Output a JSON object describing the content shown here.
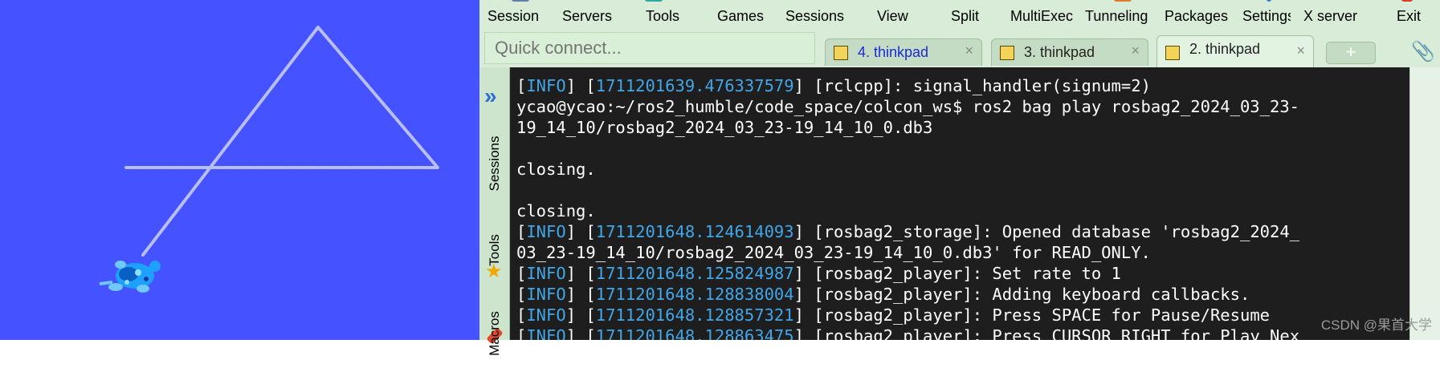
{
  "menubar": {
    "items": [
      {
        "label": "Session"
      },
      {
        "label": "Servers"
      },
      {
        "label": "Tools"
      },
      {
        "label": "Games"
      },
      {
        "label": "Sessions"
      },
      {
        "label": "View"
      },
      {
        "label": "Split"
      },
      {
        "label": "MultiExec"
      },
      {
        "label": "Tunneling"
      },
      {
        "label": "Packages"
      },
      {
        "label": "Settings"
      },
      {
        "label": "X server"
      },
      {
        "label": "Exit"
      }
    ]
  },
  "quick_connect": {
    "placeholder": "Quick connect..."
  },
  "tabs": [
    {
      "label": "4. thinkpad",
      "close": "×",
      "icon": "terminal-key-icon",
      "active": false
    },
    {
      "label": "3. thinkpad",
      "close": "×",
      "icon": "terminal-key-icon",
      "active": false
    },
    {
      "label": "2. thinkpad",
      "close": "×",
      "icon": "terminal-key-icon",
      "active": true
    }
  ],
  "new_tab": {
    "label": "+"
  },
  "sidebar": {
    "toggle_icon": "double-chevron-right-icon",
    "sessions_label": "Sessions",
    "tools_label": "Tools",
    "macros_label": "Macros"
  },
  "terminal": {
    "lines": [
      {
        "prefix": "[",
        "tag": "INFO",
        "mid": "] [",
        "time": "1711201639.476337579",
        "rest": "] [rclcpp]: signal_handler(signum=2)"
      },
      {
        "text": "ycao@ycao:~/ros2_humble/code_space/colcon_ws$ ros2 bag play rosbag2_2024_03_23-"
      },
      {
        "text": "19_14_10/rosbag2_2024_03_23-19_14_10_0.db3"
      },
      {
        "text": ""
      },
      {
        "text": "closing."
      },
      {
        "text": ""
      },
      {
        "text": "closing."
      },
      {
        "prefix": "[",
        "tag": "INFO",
        "mid": "] [",
        "time": "1711201648.124614093",
        "rest": "] [rosbag2_storage]: Opened database 'rosbag2_2024_"
      },
      {
        "text": "03_23-19_14_10/rosbag2_2024_03_23-19_14_10_0.db3' for READ_ONLY."
      },
      {
        "prefix": "[",
        "tag": "INFO",
        "mid": "] [",
        "time": "1711201648.125824987",
        "rest": "] [rosbag2_player]: Set rate to 1"
      },
      {
        "prefix": "[",
        "tag": "INFO",
        "mid": "] [",
        "time": "1711201648.128838004",
        "rest": "] [rosbag2_player]: Adding keyboard callbacks."
      },
      {
        "prefix": "[",
        "tag": "INFO",
        "mid": "] [",
        "time": "1711201648.128857321",
        "rest": "] [rosbag2_player]: Press SPACE for Pause/Resume"
      },
      {
        "prefix": "[",
        "tag": "INFO",
        "mid": "] [",
        "time": "1711201648.128863475",
        "rest": "] [rosbag2_player]: Press CURSOR_RIGHT for Play Nex"
      }
    ]
  },
  "watermark": "CSDN @果首大学",
  "colors": {
    "turtle_bg": "#4552ff",
    "trail": "#b7bff5",
    "turtle": "#1ea0ff",
    "terminal_bg": "#1e1e1e",
    "timestamp": "#41a6e8",
    "app_bg": "#d8ecd8"
  }
}
